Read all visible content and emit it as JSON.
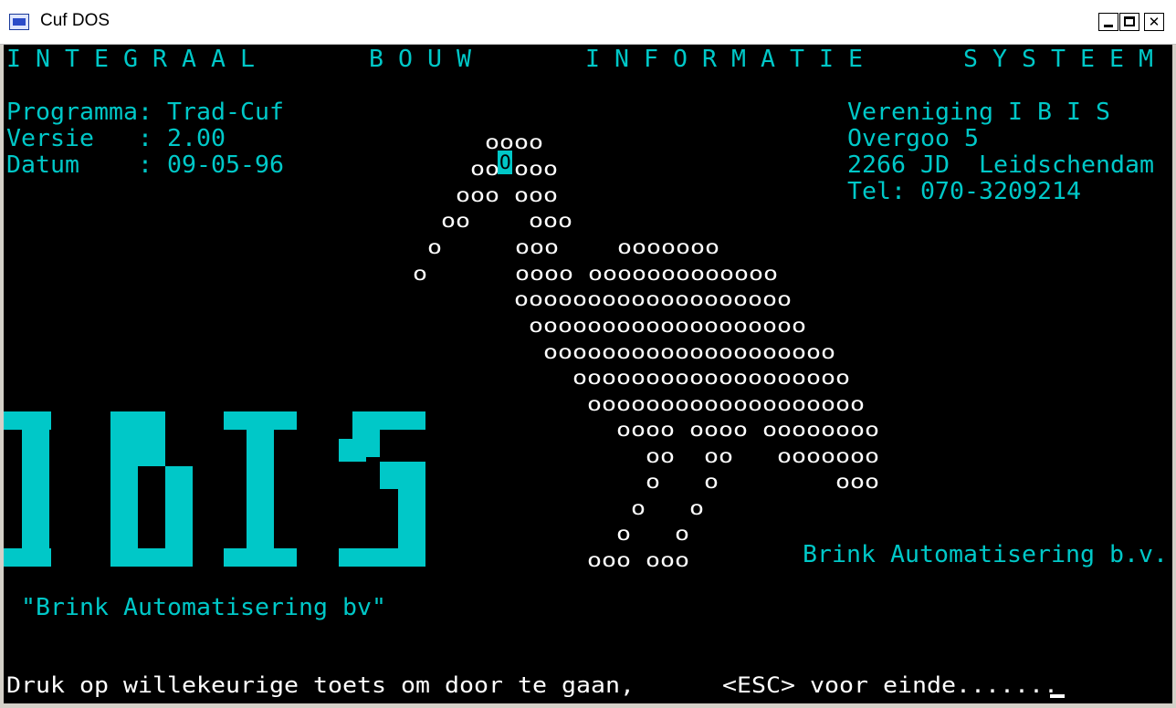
{
  "window": {
    "title": "Cuf DOS",
    "controls": {
      "minimize": "_",
      "maximize": "□",
      "close": "✕"
    }
  },
  "console": {
    "colors": {
      "background": "#000000",
      "cyan": "#00c8c8",
      "white": "#ffffff"
    },
    "banner": {
      "word1": "I N T E G R A A L",
      "word2": "B O U W",
      "word3": "I N F O R M A T I E",
      "word4": "S Y S T E E M"
    },
    "program_info": {
      "line1": "Programma: Trad-Cuf",
      "line2": "Versie   : 2.00",
      "line3": "Datum    : 09-05-96"
    },
    "contact": {
      "line1": "Vereniging I B I S",
      "line2": "Overgoo 5",
      "line3": "2266 JD  Leidschendam",
      "line4": "Tel: 070-3209214"
    },
    "ascii_art": [
      "    oooo",
      "   oo ooo",
      "  ooo ooo",
      " oo    ooo",
      "o     ooo    ooooooo",
      "o      oooo ooooooooooooo",
      "          ooooooooooooooooooo",
      "           ooooooooooooooooooo",
      "            oooooooooooooooooooo",
      "              ooooooooooooooooooo",
      "               ooooooooooooooooooo",
      "                 oooo oooo oooooooo",
      "                   oo  oo   ooooooo",
      "                   o   o        ooo",
      "                  o   o",
      "                 o   o",
      "                ooo ooo"
    ],
    "cursor_char": "O",
    "logo_text": "IBIS",
    "company_right": "Brink Automatisering b.v.",
    "company_quote": "\"Brink Automatisering bv\"",
    "prompt": "Druk op willekeurige toets om door te gaan,      <ESC> voor einde......."
  }
}
